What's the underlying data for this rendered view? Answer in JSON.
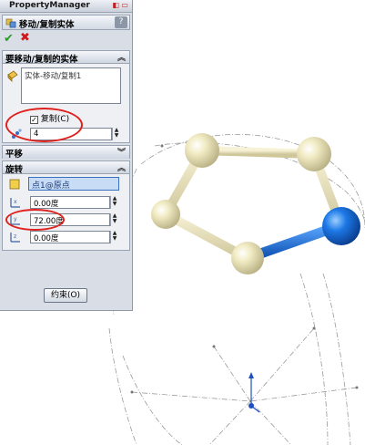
{
  "property_manager": {
    "title": "PropertyManager",
    "feature_title": "移动/复制实体",
    "help_label": "?",
    "ok_icon": "check-icon",
    "cancel_icon": "x-icon",
    "bodies_group": {
      "heading": "要移动/复制的实体",
      "selected_bodies": [
        "实体-移动/复制1"
      ],
      "copy_checkbox_label": "复制(C)",
      "copy_checked": true,
      "copy_count": "4"
    },
    "translate_group": {
      "heading": "平移"
    },
    "rotate_group": {
      "heading": "旋转",
      "origin_selection": "点1@原点",
      "x_angle": "0.00度",
      "y_angle": "72.00度",
      "z_angle": "0.00度"
    },
    "constraints_button": "约束(O)"
  },
  "colors": {
    "accent_red": "#e0201c",
    "selection_blue": "#1d6fe0",
    "sphere_yellow": "#ede6b8"
  }
}
